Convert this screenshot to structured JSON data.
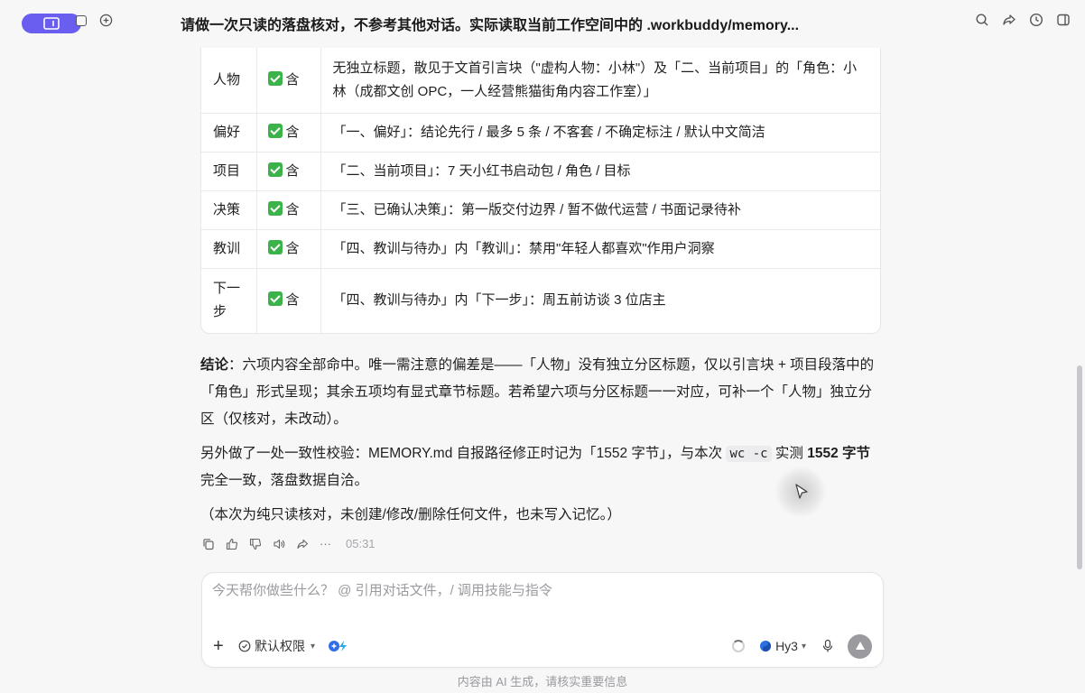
{
  "header": {
    "title": "请做一次只读的落盘核对，不参考其他对话。实际读取当前工作空间中的 .workbuddy/memory..."
  },
  "table": {
    "rows": [
      {
        "item": "人物",
        "status": "含",
        "detail": "无独立标题，散见于文首引言块（\"虚构人物：小林\"）及「二、当前项目」的「角色：小林（成都文创 OPC，一人经营熊猫街角内容工作室）」"
      },
      {
        "item": "偏好",
        "status": "含",
        "detail": "「一、偏好」：结论先行 / 最多 5 条 / 不客套 / 不确定标注 / 默认中文简洁"
      },
      {
        "item": "项目",
        "status": "含",
        "detail": "「二、当前项目」：7 天小红书启动包 / 角色 / 目标"
      },
      {
        "item": "决策",
        "status": "含",
        "detail": "「三、已确认决策」：第一版交付边界 / 暂不做代运营 / 书面记录待补"
      },
      {
        "item": "教训",
        "status": "含",
        "detail": "「四、教训与待办」内「教训」：禁用\"年轻人都喜欢\"作用户洞察"
      },
      {
        "item": "下一步",
        "status": "含",
        "detail": "「四、教训与待办」内「下一步」：周五前访谈 3 位店主"
      }
    ]
  },
  "conclusion": {
    "label": "结论",
    "text": "：六项内容全部命中。唯一需注意的偏差是——「人物」没有独立分区标题，仅以引言块 + 项目段落中的「角色」形式呈现；其余五项均有显式章节标题。若希望六项与分区标题一一对应，可补一个「人物」独立分区（仅核对，未改动）。"
  },
  "check": {
    "text_a": "另外做了一处一致性校验：MEMORY.md 自报路径修正时记为「1552 字节」，与本次 ",
    "code": "wc -c",
    "text_b": " 实测 ",
    "bold": "1552 字节",
    "text_c": "完全一致，落盘数据自洽。"
  },
  "note": "（本次为纯只读核对，未创建/修改/删除任何文件，也未写入记忆。）",
  "message_actions": {
    "icons": [
      "copy-icon",
      "thumbs-up-icon",
      "thumbs-down-icon",
      "speaker-icon",
      "share-icon",
      "more-icon"
    ],
    "more_label": "···",
    "time": "05:31"
  },
  "composer": {
    "placeholder": "今天帮你做些什么？ @ 引用对话文件，/ 调用技能与指令",
    "add_label": "+",
    "permission_label": "默认权限",
    "model_label": "Hy3"
  },
  "footer": {
    "note": "内容由 AI 生成，请核实重要信息"
  },
  "colors": {
    "accent": "#6a5ef0",
    "check_green": "#3bb34a",
    "background": "#f7f7f8"
  }
}
